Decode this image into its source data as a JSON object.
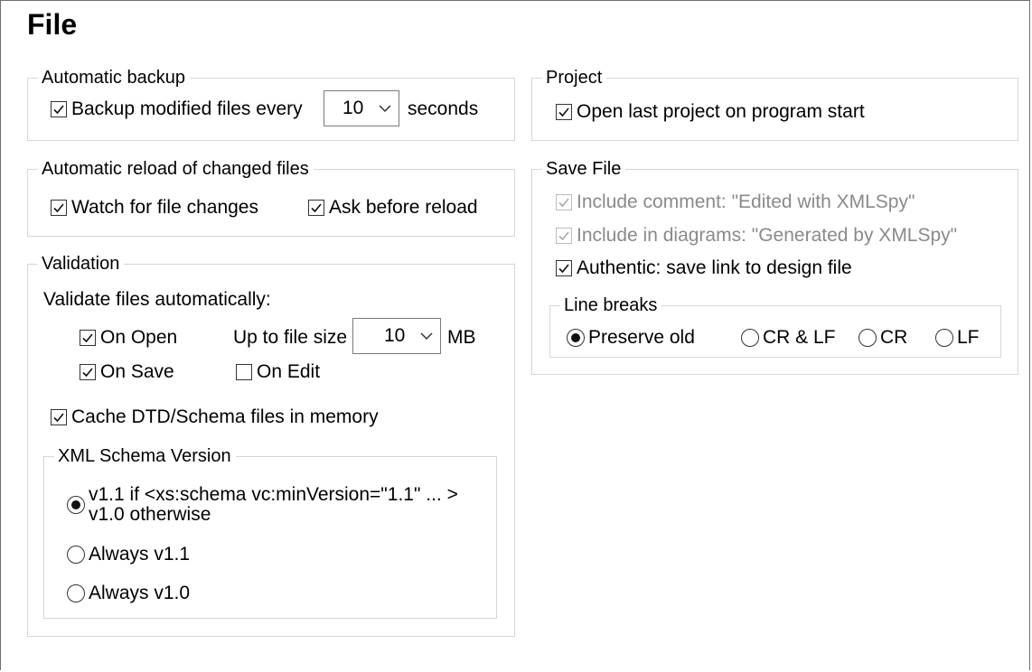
{
  "page_title": "File",
  "automatic_backup": {
    "legend": "Automatic backup",
    "backup_label": "Backup modified files every",
    "backup_checked": true,
    "interval_value": "10",
    "unit_label": "seconds"
  },
  "automatic_reload": {
    "legend": "Automatic reload of changed files",
    "watch_label": "Watch for file changes",
    "watch_checked": true,
    "ask_label": "Ask before reload",
    "ask_checked": true
  },
  "validation": {
    "legend": "Validation",
    "validate_label": "Validate files automatically:",
    "on_open_label": "On Open",
    "on_save_label": "On Save",
    "on_edit_label": "On Edit",
    "file_size_label": "Up to file size",
    "file_size_value": "10",
    "file_size_unit": "MB",
    "cache_label": "Cache DTD/Schema files in memory",
    "schema_version": {
      "legend": "XML Schema Version",
      "option_1_line1": "v1.1 if <xs:schema vc:minVersion=\"1.1\" ... >",
      "option_1_line2": "v1.0 otherwise",
      "option_2": "Always v1.1",
      "option_3": "Always v1.0",
      "selected": "option_1"
    }
  },
  "project": {
    "legend": "Project",
    "open_last_label": "Open last project on program start",
    "open_last_checked": true
  },
  "save_file": {
    "legend": "Save File",
    "include_comment_label": "Include comment: \"Edited with XMLSpy\"",
    "include_diagrams_label": "Include in diagrams: \"Generated by XMLSpy\"",
    "authentic_label": "Authentic: save link to design file",
    "line_breaks": {
      "legend": "Line breaks",
      "preserve_old": "Preserve old",
      "cr_lf": "CR & LF",
      "cr": "CR",
      "lf": "LF",
      "selected": "preserve_old"
    }
  },
  "colors": {
    "group_border": "#d6d6d6",
    "disabled_text": "#8a8a8a"
  }
}
